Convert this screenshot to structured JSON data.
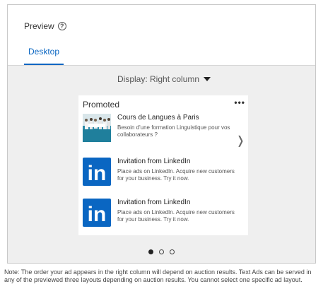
{
  "header": {
    "preview_label": "Preview",
    "help_icon": "?",
    "tabs": [
      {
        "label": "Desktop",
        "active": true
      }
    ]
  },
  "display": {
    "label": "Display: Right column"
  },
  "card": {
    "sponsor_label": "Promoted",
    "more_icon": "•••",
    "next_icon": "❭",
    "ads": [
      {
        "title": "Cours de Langues à Paris",
        "body": "Besoin d'une formation Linguistique pour vos collaborateurs ?",
        "image": "classroom-photo"
      },
      {
        "title": "Invitation from LinkedIn",
        "body": "Place ads on LinkedIn. Acquire new customers for your business. Try it now.",
        "image": "linkedin-logo"
      },
      {
        "title": "Invitation from LinkedIn",
        "body": "Place ads on LinkedIn. Acquire new customers for your business. Try it now.",
        "image": "linkedin-logo"
      }
    ],
    "linkedin_mark": "in"
  },
  "pagination": {
    "count": 3,
    "active_index": 0
  },
  "note": "Note: The order your ad appears in the right column will depend on auction results. Text Ads can be served in any of the previewed three layouts depending on auction results. You cannot select one specific ad layout.",
  "colors": {
    "accent": "#0a66c2",
    "linkedin_blue": "#0a66c2",
    "canvas": "#efefef"
  }
}
